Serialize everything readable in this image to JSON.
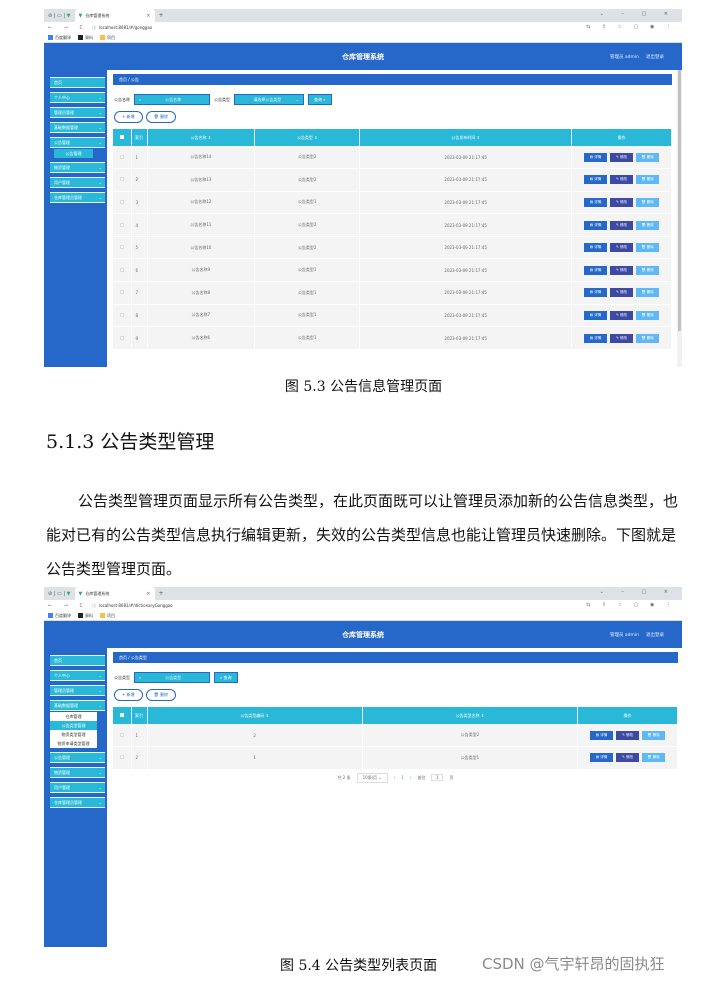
{
  "shot1": {
    "browser": {
      "tab_title": "仓库管理系统",
      "url": "localhost:8081/#/gonggao",
      "bookmarks": [
        "百度翻译",
        "資料",
        "项目"
      ]
    },
    "header": {
      "title": "仓库管理系统",
      "user": "管理员 admin",
      "logout": "退出登录"
    },
    "sidebar": {
      "items": [
        {
          "label": "首页"
        },
        {
          "label": "个人中心"
        },
        {
          "label": "管理员管理"
        },
        {
          "label": "基础数据管理"
        },
        {
          "label": "公告管理"
        },
        {
          "label": "物资管理"
        },
        {
          "label": "用户管理"
        },
        {
          "label": "仓库管理员管理"
        }
      ],
      "sub_active": "公告管理"
    },
    "breadcrumb": "首页 / 公告",
    "search": {
      "name_label": "公告名称",
      "name_placeholder": "公告名称",
      "type_label": "公告类型",
      "type_placeholder": "请选择公告类型",
      "search_button": "查询 ⌕"
    },
    "actions": {
      "add": "+ 新增",
      "delete": "🗑 删除"
    },
    "table": {
      "headers": [
        "",
        "索引",
        "公告名称 ⇕",
        "公告类型 ⇕",
        "公告发布时间 ⇕",
        "操作"
      ],
      "rows": [
        {
          "index": "1",
          "name": "公告名称14",
          "type": "公告类型2",
          "time": "2023-03-09 21:17:45"
        },
        {
          "index": "2",
          "name": "公告名称13",
          "type": "公告类型2",
          "time": "2023-03-09 21:17:45"
        },
        {
          "index": "3",
          "name": "公告名称12",
          "type": "公告类型1",
          "time": "2023-03-09 21:17:45"
        },
        {
          "index": "4",
          "name": "公告名称11",
          "type": "公告类型2",
          "time": "2023-03-09 21:17:45"
        },
        {
          "index": "5",
          "name": "公告名称10",
          "type": "公告类型2",
          "time": "2023-03-09 21:17:45"
        },
        {
          "index": "6",
          "name": "公告名称9",
          "type": "公告类型1",
          "time": "2023-03-09 21:17:45"
        },
        {
          "index": "7",
          "name": "公告名称8",
          "type": "公告类型1",
          "time": "2023-03-09 21:17:45"
        },
        {
          "index": "8",
          "name": "公告名称7",
          "type": "公告类型1",
          "time": "2023-03-09 21:17:45"
        },
        {
          "index": "9",
          "name": "公告名称6",
          "type": "公告类型1",
          "time": "2023-03-09 21:17:45"
        }
      ],
      "ops": {
        "detail": "▤ 详情",
        "edit": "✎ 修改",
        "del": "🗑 删除"
      }
    }
  },
  "caption1": "图 5.3  公告信息管理页面",
  "heading": "5.1.3 公告类型管理",
  "paragraph": "公告类型管理页面显示所有公告类型，在此页面既可以让管理员添加新的公告信息类型，也能对已有的公告类型信息执行编辑更新，失效的公告类型信息也能让管理员快速删除。下图就是公告类型管理页面。",
  "shot2": {
    "browser": {
      "tab_title": "仓库管理系统",
      "url": "localhost:8081/#/dictionaryGonggao",
      "bookmarks": [
        "百度翻译",
        "資料",
        "项目"
      ]
    },
    "header": {
      "title": "仓库管理系统",
      "user": "管理员 admin",
      "logout": "退出登录"
    },
    "sidebar": {
      "items_top": [
        {
          "label": "首页"
        },
        {
          "label": "个人中心"
        },
        {
          "label": "管理员管理"
        },
        {
          "label": "基础数据管理"
        }
      ],
      "popup": [
        "仓库管理",
        "公告类型管理",
        "物资类型管理",
        "物资申请类型管理"
      ],
      "popup_active": 1,
      "items_bottom": [
        {
          "label": "公告管理"
        },
        {
          "label": "物资管理"
        },
        {
          "label": "用户管理"
        },
        {
          "label": "仓库管理员管理"
        }
      ]
    },
    "breadcrumb": "首页 / 公告类型",
    "search": {
      "type_label": "公告类型",
      "type_placeholder": "公告类型",
      "search_button": "⌕ 查询"
    },
    "actions": {
      "add": "+ 新增",
      "delete": "🗑 删除"
    },
    "table": {
      "headers": [
        "",
        "索引",
        "公告类型编码 ⇕",
        "公告类型名称 ⇕",
        "操作"
      ],
      "rows": [
        {
          "index": "1",
          "code": "2",
          "name": "公告类型2"
        },
        {
          "index": "2",
          "code": "1",
          "name": "公告类型1"
        }
      ],
      "ops": {
        "detail": "▤ 详情",
        "edit": "✎ 修改",
        "del": "🗑 删除"
      }
    },
    "pagination": {
      "total": "共 2 条",
      "page_size": "10条/页",
      "current": "1",
      "goto_label": "前往",
      "goto_value": "1",
      "page_suffix": "页"
    }
  },
  "caption2": "图 5.4  公告类型列表页面",
  "watermark": "CSDN @气宇轩昂的固执狂"
}
